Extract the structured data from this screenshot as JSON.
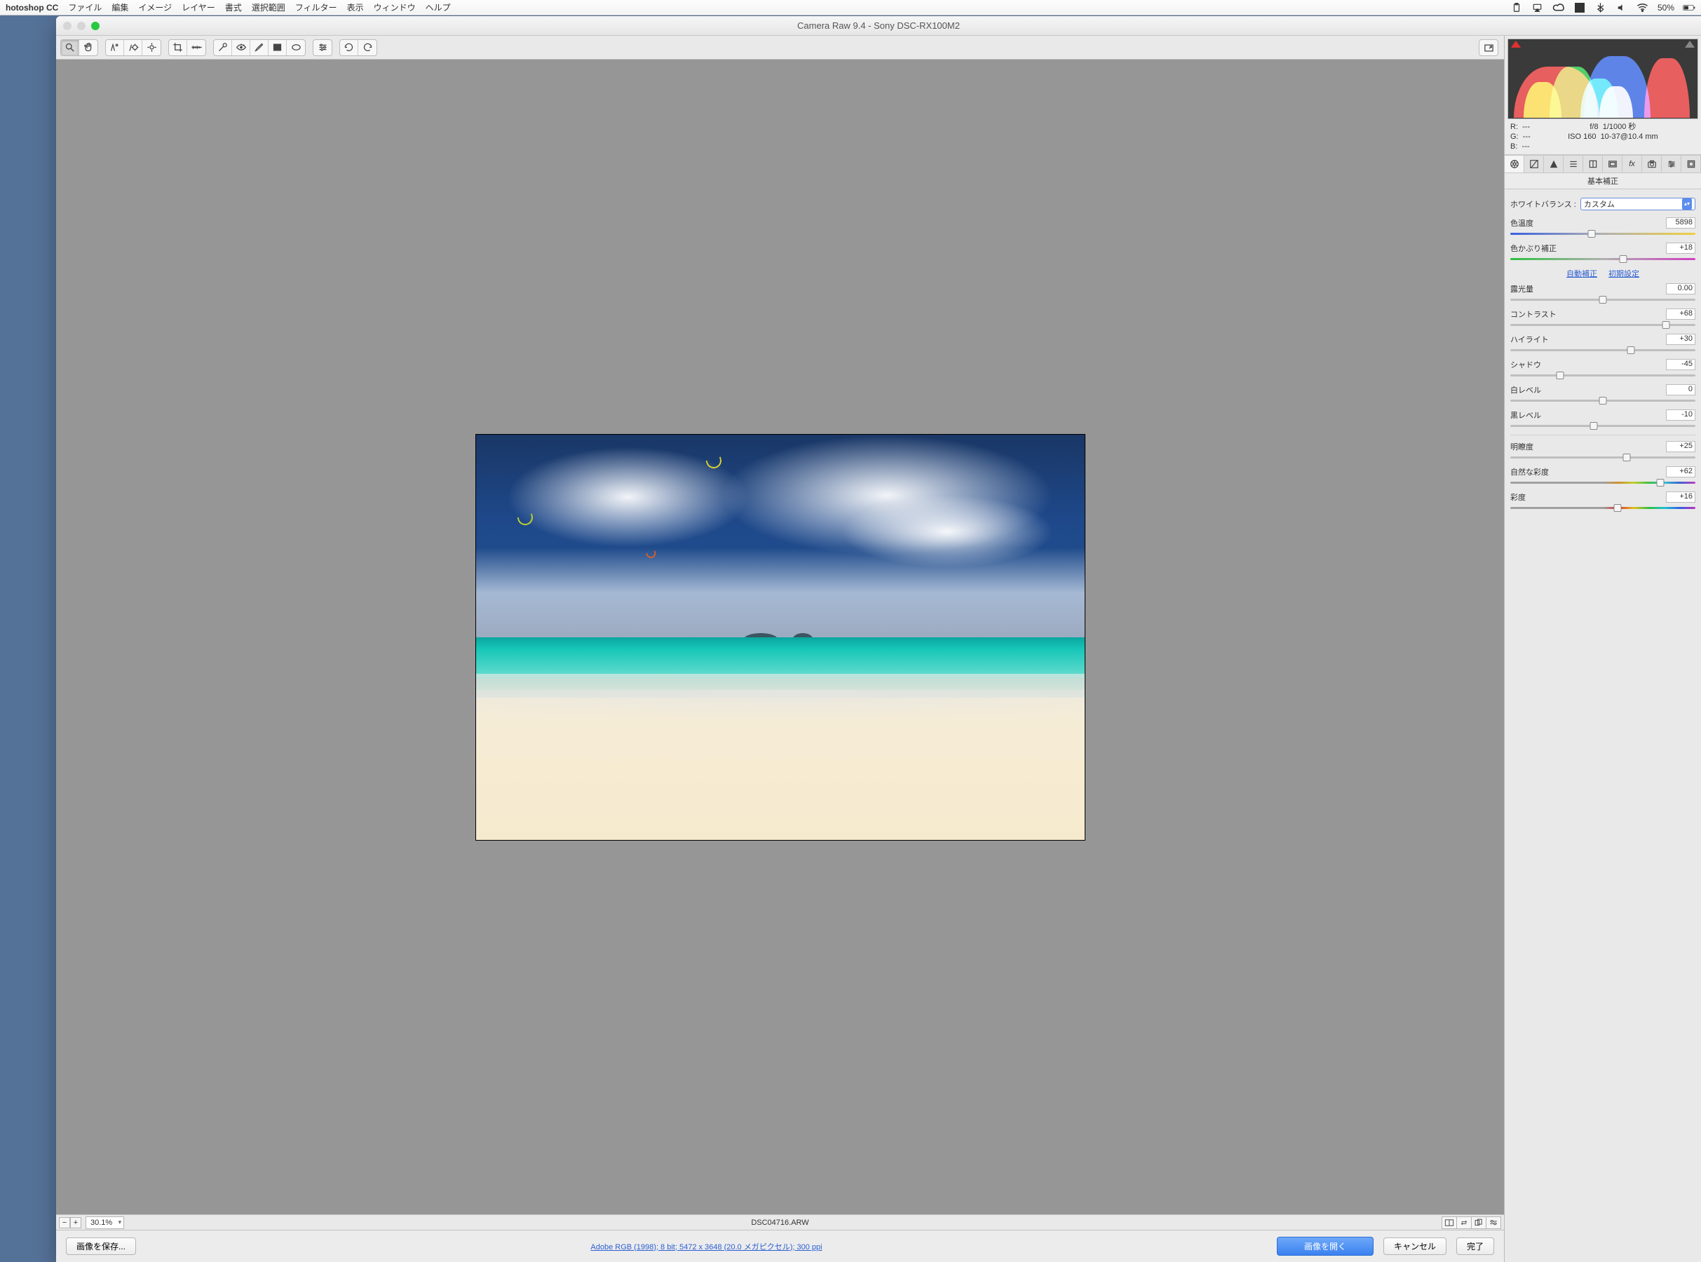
{
  "menubar": {
    "app_name": "hotoshop CC",
    "items": [
      "ファイル",
      "編集",
      "イメージ",
      "レイヤー",
      "書式",
      "選択範囲",
      "フィルター",
      "表示",
      "ウィンドウ",
      "ヘルプ"
    ],
    "battery_pct": "50%"
  },
  "window": {
    "title": "Camera Raw 9.4  -  Sony DSC-RX100M2"
  },
  "toolbar_icons": [
    "zoom",
    "hand",
    "white-balance",
    "color-sampler",
    "target-adjust",
    "crop",
    "straighten",
    "spot-removal",
    "red-eye",
    "adjustment-brush",
    "graduated-filter",
    "radial-filter",
    "preferences",
    "rotate-ccw",
    "rotate-cw"
  ],
  "preview": {
    "zoom": "30.1%",
    "filename": "DSC04716.ARW"
  },
  "info": {
    "rgb": {
      "r": "R:",
      "g": "G:",
      "b": "B:",
      "val": "---"
    },
    "exif_line1_left": "f/8",
    "exif_line1_right": "1/1000 秒",
    "exif_line2_left": "ISO 160",
    "exif_line2_right": "10-37@10.4 mm"
  },
  "panel": {
    "title": "基本補正",
    "wb_label": "ホワイトバランス :",
    "wb_value": "カスタム",
    "links": {
      "auto": "自動補正",
      "default": "初期設定"
    },
    "sliders": {
      "temperature": {
        "label": "色温度",
        "value": "5898",
        "pos": 44
      },
      "tint": {
        "label": "色かぶり補正",
        "value": "+18",
        "pos": 61
      },
      "exposure": {
        "label": "露光量",
        "value": "0.00",
        "pos": 50
      },
      "contrast": {
        "label": "コントラスト",
        "value": "+68",
        "pos": 84
      },
      "highlights": {
        "label": "ハイライト",
        "value": "+30",
        "pos": 65
      },
      "shadows": {
        "label": "シャドウ",
        "value": "-45",
        "pos": 27
      },
      "whites": {
        "label": "白レベル",
        "value": "0",
        "pos": 50
      },
      "blacks": {
        "label": "黒レベル",
        "value": "-10",
        "pos": 45
      },
      "clarity": {
        "label": "明瞭度",
        "value": "+25",
        "pos": 63
      },
      "vibrance": {
        "label": "自然な彩度",
        "value": "+62",
        "pos": 81
      },
      "saturation": {
        "label": "彩度",
        "value": "+16",
        "pos": 58
      }
    }
  },
  "actions": {
    "save": "画像を保存...",
    "profile": "Adobe RGB (1998); 8 bit; 5472 x 3648 (20.0 メガピクセル); 300 ppi",
    "open": "画像を開く",
    "cancel": "キャンセル",
    "done": "完了"
  }
}
